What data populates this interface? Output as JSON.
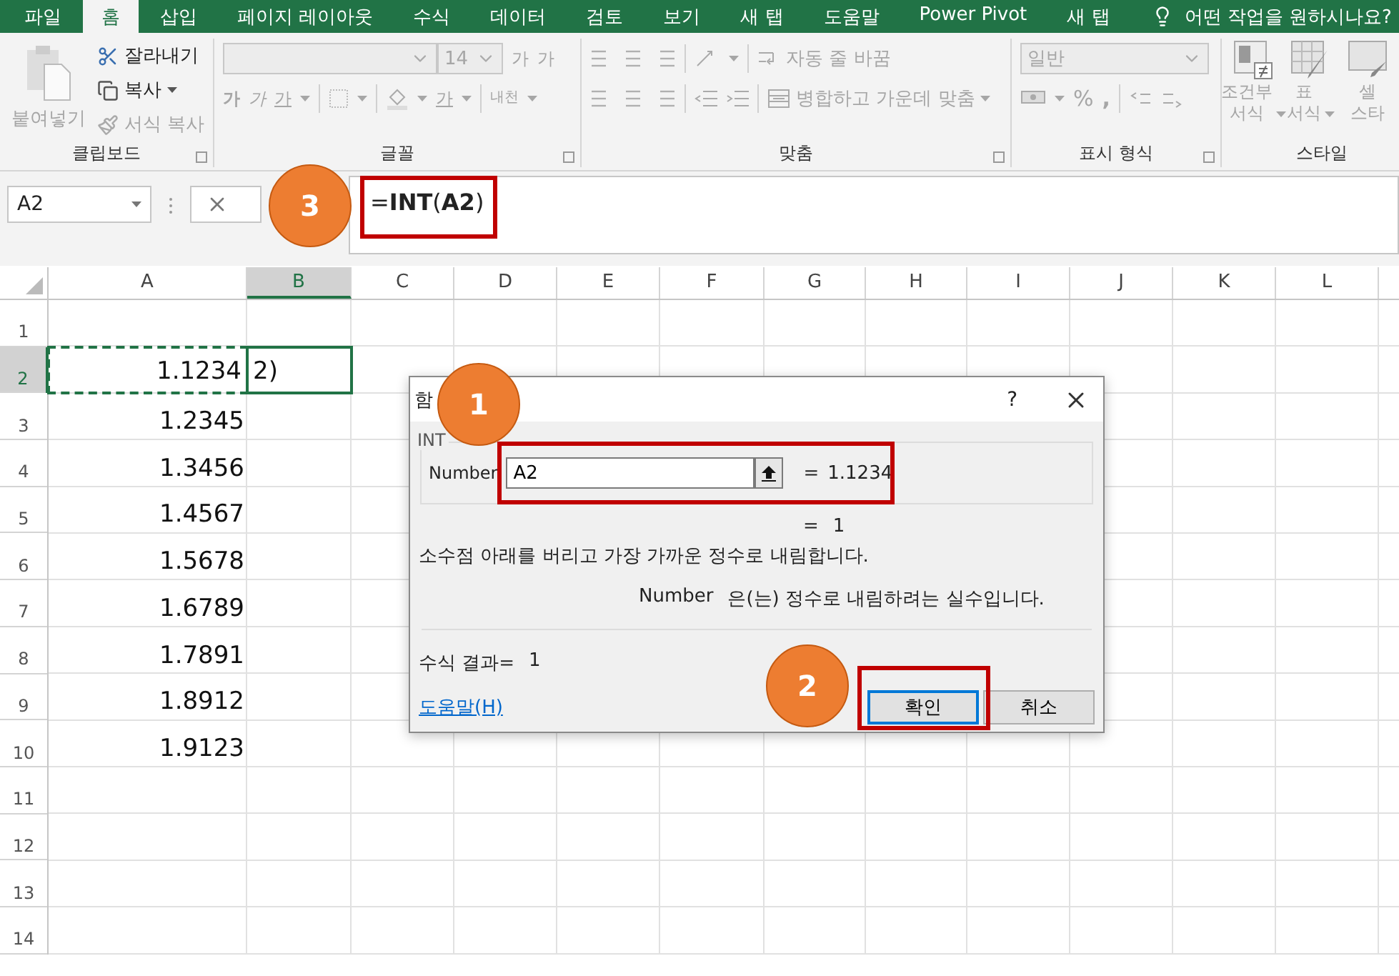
{
  "ribbon_tabs": [
    {
      "label": "파일",
      "selected": false
    },
    {
      "label": "홈",
      "selected": true
    },
    {
      "label": "삽입",
      "selected": false
    },
    {
      "label": "페이지 레이아웃",
      "selected": false
    },
    {
      "label": "수식",
      "selected": false
    },
    {
      "label": "데이터",
      "selected": false
    },
    {
      "label": "검토",
      "selected": false
    },
    {
      "label": "보기",
      "selected": false
    },
    {
      "label": "새 탭",
      "selected": false
    },
    {
      "label": "도움말",
      "selected": false
    },
    {
      "label": "Power Pivot",
      "selected": false
    },
    {
      "label": "새 탭",
      "selected": false
    }
  ],
  "tell_me": "어떤 작업을 원하시나요?",
  "clipboard": {
    "label": "클립보드",
    "paste": {
      "label": "붙여넣기",
      "disabled": true
    },
    "commands": [
      {
        "kind": "cut",
        "label": "잘라내기",
        "disabled": false
      },
      {
        "kind": "copy",
        "label": "복사",
        "disabled": false
      },
      {
        "kind": "painter",
        "label": "서식 복사",
        "disabled": true
      }
    ]
  },
  "font": {
    "label": "글꼴",
    "size": "14",
    "grow": "가",
    "shrink": "가",
    "styles": [
      {
        "kind": "bold",
        "label": "가"
      },
      {
        "kind": "italic",
        "label": "가"
      },
      {
        "kind": "underline",
        "label": "가"
      }
    ],
    "font_color": "가",
    "phonetic": "내천"
  },
  "alignment": {
    "label": "맞춤",
    "wrap": "자동 줄 바꿈",
    "merge": "병합하고 가운데 맞춤"
  },
  "number": {
    "label": "표시 형식",
    "format": "일반",
    "percent": "%",
    "comma": ","
  },
  "styles": {
    "label": "스타일",
    "items": [
      {
        "kind": "conditional",
        "lines": [
          "조건부",
          "서식"
        ],
        "dropdown": true
      },
      {
        "kind": "table",
        "lines": [
          "표",
          "서식"
        ],
        "dropdown": true
      },
      {
        "kind": "cell",
        "lines": [
          "셀",
          "스타"
        ],
        "dropdown": false
      }
    ]
  },
  "formula_bar": {
    "name_box": "A2",
    "formula": "=**INT**(**A2**)"
  },
  "columns": [
    {
      "label": "A",
      "selected": false
    },
    {
      "label": "B",
      "selected": true
    },
    {
      "label": "C",
      "selected": false
    },
    {
      "label": "D",
      "selected": false
    },
    {
      "label": "E",
      "selected": false
    },
    {
      "label": "F",
      "selected": false
    },
    {
      "label": "G",
      "selected": false
    },
    {
      "label": "H",
      "selected": false
    },
    {
      "label": "I",
      "selected": false
    },
    {
      "label": "J",
      "selected": false
    },
    {
      "label": "K",
      "selected": false
    },
    {
      "label": "L",
      "selected": false
    }
  ],
  "rows": [
    {
      "label": "1",
      "selected": false
    },
    {
      "label": "2",
      "selected": true,
      "cells": [
        {
          "kind": "number",
          "text": "1.1234",
          "referenced": true
        },
        {
          "kind": "editing",
          "text": "2)",
          "referenced": false
        }
      ]
    },
    {
      "label": "3",
      "selected": false,
      "cells": [
        {
          "kind": "number",
          "text": "1.2345",
          "referenced": false
        }
      ]
    },
    {
      "label": "4",
      "selected": false,
      "cells": [
        {
          "kind": "number",
          "text": "1.3456",
          "referenced": false
        }
      ]
    },
    {
      "label": "5",
      "selected": false,
      "cells": [
        {
          "kind": "number",
          "text": "1.4567",
          "referenced": false
        }
      ]
    },
    {
      "label": "6",
      "selected": false,
      "cells": [
        {
          "kind": "number",
          "text": "1.5678",
          "referenced": false
        }
      ]
    },
    {
      "label": "7",
      "selected": false,
      "cells": [
        {
          "kind": "number",
          "text": "1.6789",
          "referenced": false
        }
      ]
    },
    {
      "label": "8",
      "selected": false,
      "cells": [
        {
          "kind": "number",
          "text": "1.7891",
          "referenced": false
        }
      ]
    },
    {
      "label": "9",
      "selected": false,
      "cells": [
        {
          "kind": "number",
          "text": "1.8912",
          "referenced": false
        }
      ]
    },
    {
      "label": "10",
      "selected": false,
      "cells": [
        {
          "kind": "number",
          "text": "1.9123",
          "referenced": false
        }
      ]
    },
    {
      "label": "11",
      "selected": false
    },
    {
      "label": "12",
      "selected": false
    },
    {
      "label": "13",
      "selected": false
    },
    {
      "label": "14",
      "selected": false
    }
  ],
  "dialog": {
    "title": "함",
    "help": "?",
    "function_name": "INT",
    "argument": {
      "label": "Number",
      "value": "A2",
      "equals": "=",
      "result": "1.1234"
    },
    "result": {
      "equals": "=",
      "value": "1"
    },
    "description": "소수점 아래를 버리고 가장 가까운 정수로 내림합니다.",
    "argument_help": {
      "name": "Number",
      "text": "은(는) 정수로 내림하려는 실수입니다."
    },
    "formula_result": {
      "label": "수식 결과=",
      "value": "1"
    },
    "help_link": "도움말(H)",
    "buttons": [
      {
        "label": "확인",
        "default": true
      },
      {
        "label": "취소",
        "default": false
      }
    ]
  },
  "callouts": [
    "1",
    "2",
    "3"
  ]
}
